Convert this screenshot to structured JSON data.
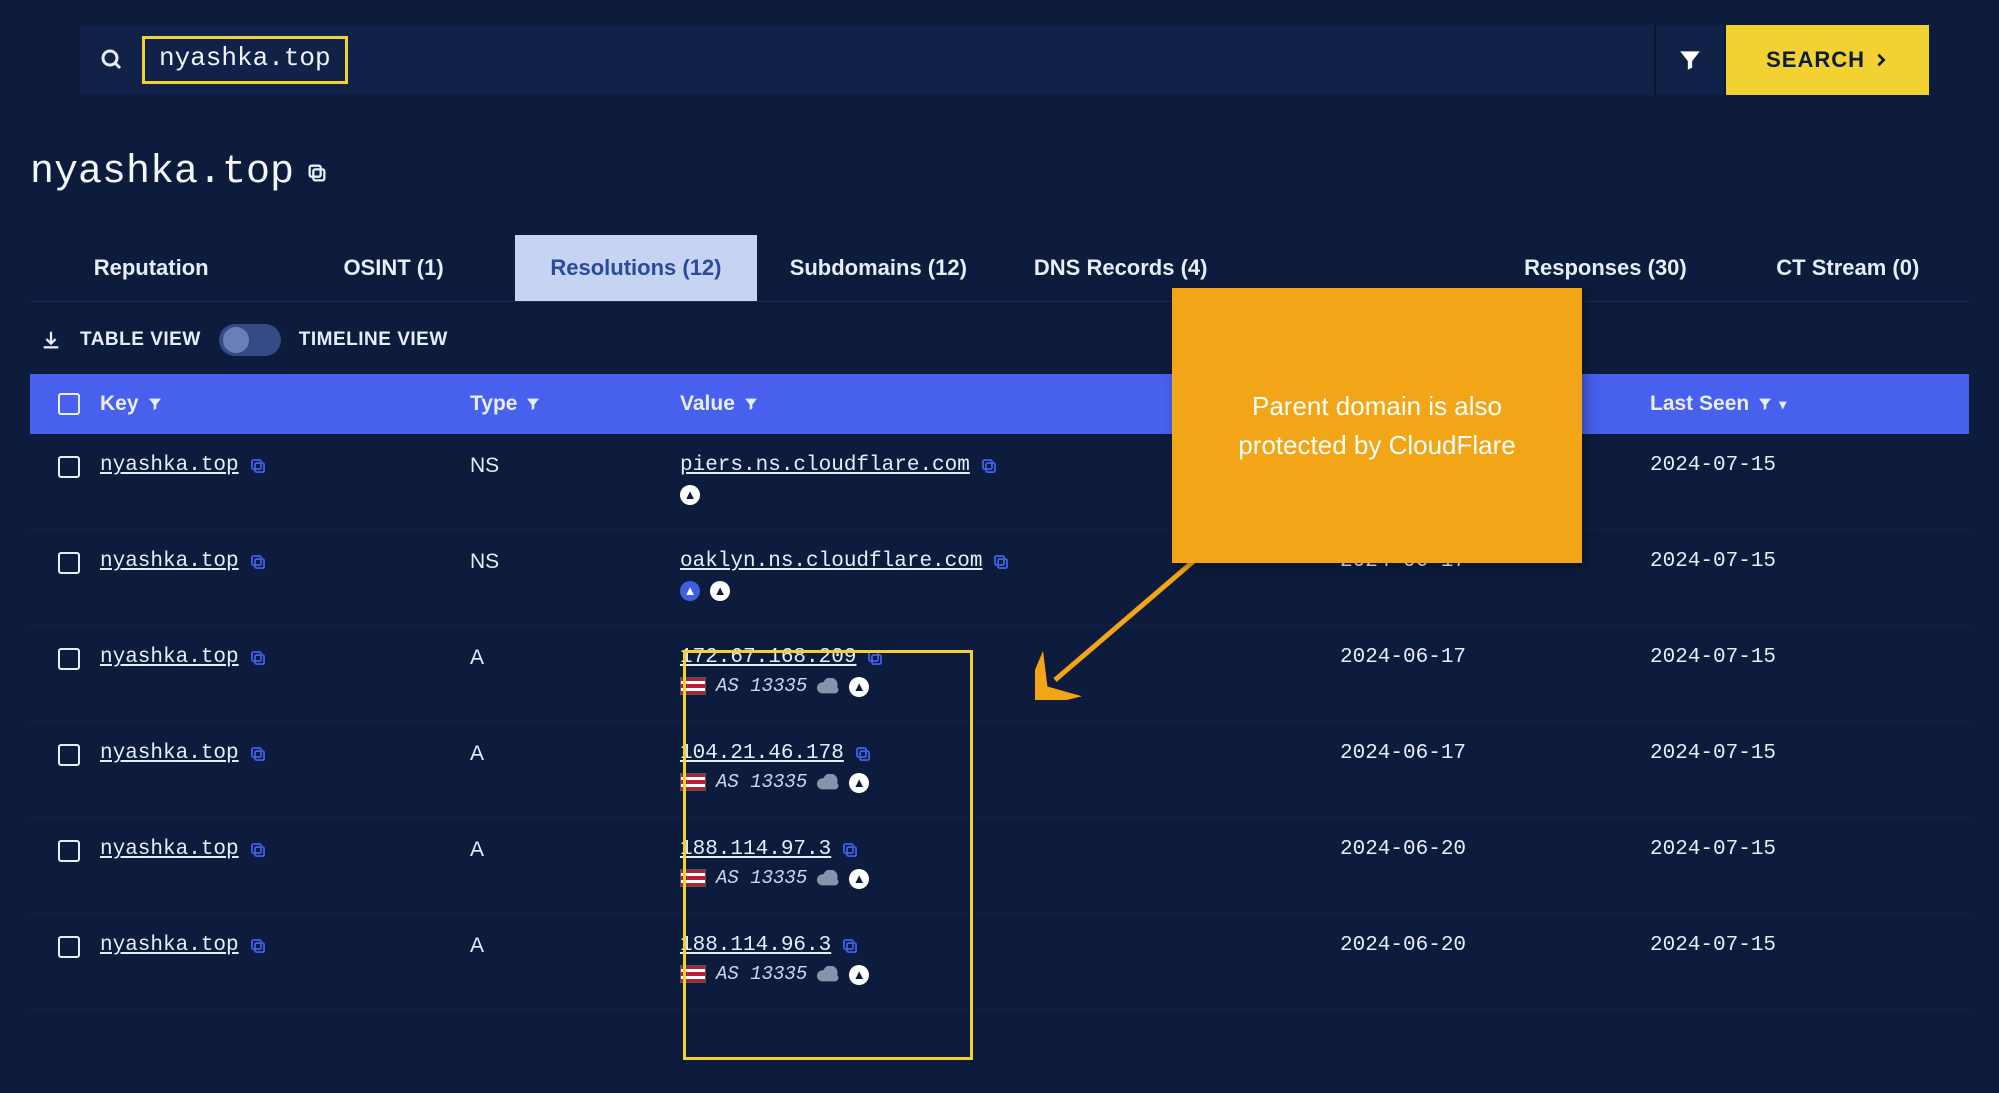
{
  "search": {
    "query": "nyashka.top",
    "button": "SEARCH"
  },
  "page_title": "nyashka.top",
  "tabs": [
    {
      "label": "Reputation"
    },
    {
      "label": "OSINT (1)"
    },
    {
      "label": "Resolutions (12)"
    },
    {
      "label": "Subdomains (12)"
    },
    {
      "label": "DNS Records (4)"
    },
    {
      "label": ""
    },
    {
      "label": "Responses (30)"
    },
    {
      "label": "CT Stream (0)"
    }
  ],
  "view": {
    "table": "TABLE VIEW",
    "timeline": "TIMELINE VIEW"
  },
  "columns": {
    "key": "Key",
    "type": "Type",
    "value": "Value",
    "first_seen": "",
    "last_seen": "Last Seen"
  },
  "rows": [
    {
      "key": "nyashka.top",
      "type": "NS",
      "value": "piers.ns.cloudflare.com",
      "as": "",
      "flag": false,
      "fire": [
        "white"
      ],
      "first_seen": "",
      "last_seen": "2024-07-15"
    },
    {
      "key": "nyashka.top",
      "type": "NS",
      "value": "oaklyn.ns.cloudflare.com",
      "as": "",
      "flag": false,
      "fire": [
        "blue",
        "white"
      ],
      "first_seen": "2024-06-17",
      "last_seen": "2024-07-15"
    },
    {
      "key": "nyashka.top",
      "type": "A",
      "value": "172.67.168.209",
      "as": "AS 13335",
      "flag": true,
      "cloud": true,
      "fire": [
        "white"
      ],
      "first_seen": "2024-06-17",
      "last_seen": "2024-07-15"
    },
    {
      "key": "nyashka.top",
      "type": "A",
      "value": "104.21.46.178",
      "as": "AS 13335",
      "flag": true,
      "cloud": true,
      "fire": [
        "white"
      ],
      "first_seen": "2024-06-17",
      "last_seen": "2024-07-15"
    },
    {
      "key": "nyashka.top",
      "type": "A",
      "value": "188.114.97.3",
      "as": "AS 13335",
      "flag": true,
      "cloud": true,
      "fire": [
        "white"
      ],
      "first_seen": "2024-06-20",
      "last_seen": "2024-07-15"
    },
    {
      "key": "nyashka.top",
      "type": "A",
      "value": "188.114.96.3",
      "as": "AS 13335",
      "flag": true,
      "cloud": true,
      "fire": [
        "white"
      ],
      "first_seen": "2024-06-20",
      "last_seen": "2024-07-15"
    }
  ],
  "callout": "Parent domain is also protected by CloudFlare"
}
